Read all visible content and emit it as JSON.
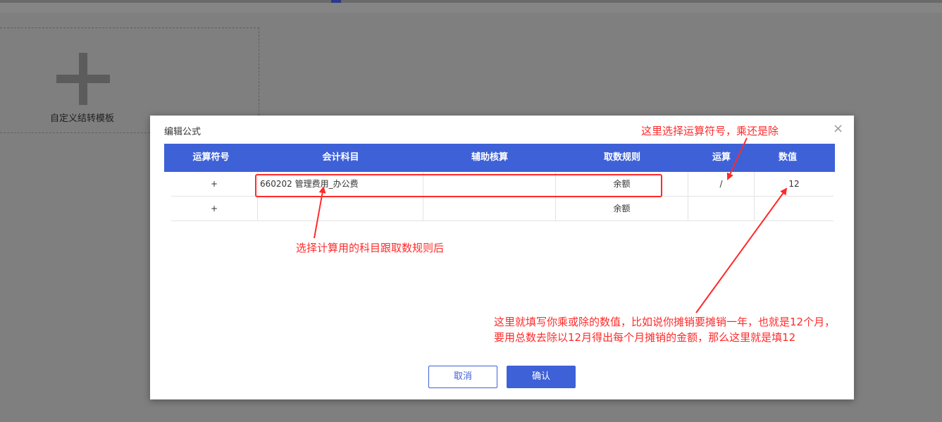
{
  "template": {
    "label": "自定义结转模板"
  },
  "dialog": {
    "title": "编辑公式",
    "close_icon": "×",
    "headers": [
      "运算符号",
      "会计科目",
      "辅助核算",
      "取数规则",
      "运算",
      "数值"
    ],
    "rows": [
      {
        "op_sign": "+",
        "account": "660202 管理费用_办公费",
        "aux": "",
        "rule": "余额",
        "operation": "/",
        "value": "12"
      },
      {
        "op_sign": "+",
        "account": "",
        "aux": "",
        "rule": "余额",
        "operation": "",
        "value": ""
      }
    ],
    "cancel_label": "取消",
    "confirm_label": "确认"
  },
  "annotations": {
    "operator_note": "这里选择运算符号，乘还是除",
    "account_note": "选择计算用的科目跟取数规则后",
    "value_note_line1": "这里就填写你乘或除的数值，比如说你摊销要摊销一年，也就是12个月，",
    "value_note_line2": "要用总数去除以12月得出每个月摊销的金额，那么这里就是填12"
  },
  "colors": {
    "accent": "#3e61d7",
    "annotation": "#ff2a2a",
    "overlay": "#7f7f7f"
  }
}
